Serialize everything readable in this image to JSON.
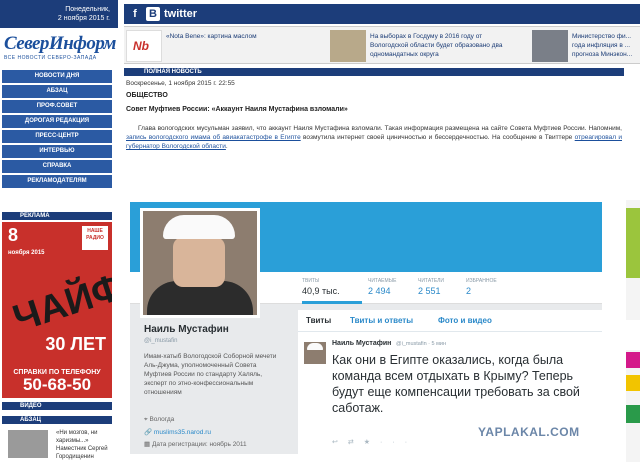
{
  "header": {
    "weekday": "Понедельник,",
    "date": "2 ноября 2015 г.",
    "logo_main": "СеверИнформ",
    "logo_sub": "ВСЕ НОВОСТИ СЕВЕРО-ЗАПАДА"
  },
  "nav": {
    "items": [
      {
        "label": "НОВОСТИ ДНЯ"
      },
      {
        "label": "АБЗАЦ"
      },
      {
        "label": "ПРОФ.СОВЕТ"
      },
      {
        "label": "ДОРОГАЯ РЕДАКЦИЯ"
      },
      {
        "label": "ПРЕСС-ЦЕНТР"
      },
      {
        "label": "ИНТЕРВЬЮ"
      },
      {
        "label": "СПРАВКА"
      },
      {
        "label": "РЕКЛАМОДАТЕЛЯМ"
      }
    ]
  },
  "sidebar": {
    "ad_label": "РЕКЛАМА",
    "video_label": "ВИДЕО",
    "abzac_label": "АБЗАЦ",
    "ad": {
      "date": "8",
      "month": "ноября 2015",
      "badge": "НАШЕ РАДИО",
      "title": "ЧАЙФ",
      "anniversary": "30 ЛЕТ",
      "phone_label": "СПРАВКИ ПО ТЕЛЕФОНУ",
      "phone": "50-68-50"
    },
    "quote": {
      "text": "«Ни мозгов, ни харизмы...»",
      "author": "Наместник Сергей Городищенин"
    }
  },
  "social": {
    "facebook": "f",
    "vk": "B",
    "twitter": "twitter"
  },
  "news_strip": [
    {
      "text": "«Nota Bene»: картина маслом"
    },
    {
      "text": "На выборах в Госдуму в 2016 году от Вологодской области будет образовано два одномандатных округа"
    },
    {
      "text": "Министерство фи... года инфляция в ... прогноза Минэкон..."
    }
  ],
  "article": {
    "urgent_label": "ПОЛНАЯ НОВОСТЬ",
    "datetime": "Воскресенье, 1 ноября 2015 г. 22:55",
    "rubric": "ОБЩЕСТВО",
    "headline": "Совет Муфтиев России: «Аккаунт Наиля Мустафина взломали»",
    "p1": "Глава вологодских мусульман заявил, что аккаунт Наиля Мустафина взломали. Такая информация размещена на сайте Совета Муфтиев России. Напомним, ",
    "p1_link": "запись вологодского имама об авиакатастрофе в Египте",
    "p2": " возмутила интернет своей циничностью и бессердечностью. На сообщение в Твиттере ",
    "p2_link": "отреагировал и губернатор Вологодской области",
    "p3": "."
  },
  "twitter_profile": {
    "stats": [
      {
        "label": "ТВИТЫ",
        "value": "40,9 тыс."
      },
      {
        "label": "ЧИТАЕМЫЕ",
        "value": "2 494"
      },
      {
        "label": "ЧИТАТЕЛИ",
        "value": "2 551"
      },
      {
        "label": "ИЗБРАННОЕ",
        "value": "2"
      }
    ],
    "name": "Наиль Мустафин",
    "handle": "@i_mustafin",
    "bio": "Имам-хатыб Вологодской Соборной мечети Аль-Джума, уполномоченный Совета Муфтиев России по стандарту Халяль, эксперт по этно-конфессиональным отношениям",
    "location": "Вологда",
    "website": "muslims35.narod.ru",
    "joined": "Дата регистрации: ноябрь 2011",
    "tabs": [
      "Твиты",
      "Твиты и ответы",
      "Фото и видео"
    ],
    "tweet": {
      "name": "Наиль Мустафин",
      "handle": "@i_mustafin · 5 мин",
      "text": "Как они в Египте оказались, когда была команда всем отдыхать в Крыму? Теперь будут еще компенсации требовать за свой саботаж."
    }
  },
  "watermark": "YAPLAKAL.COM"
}
